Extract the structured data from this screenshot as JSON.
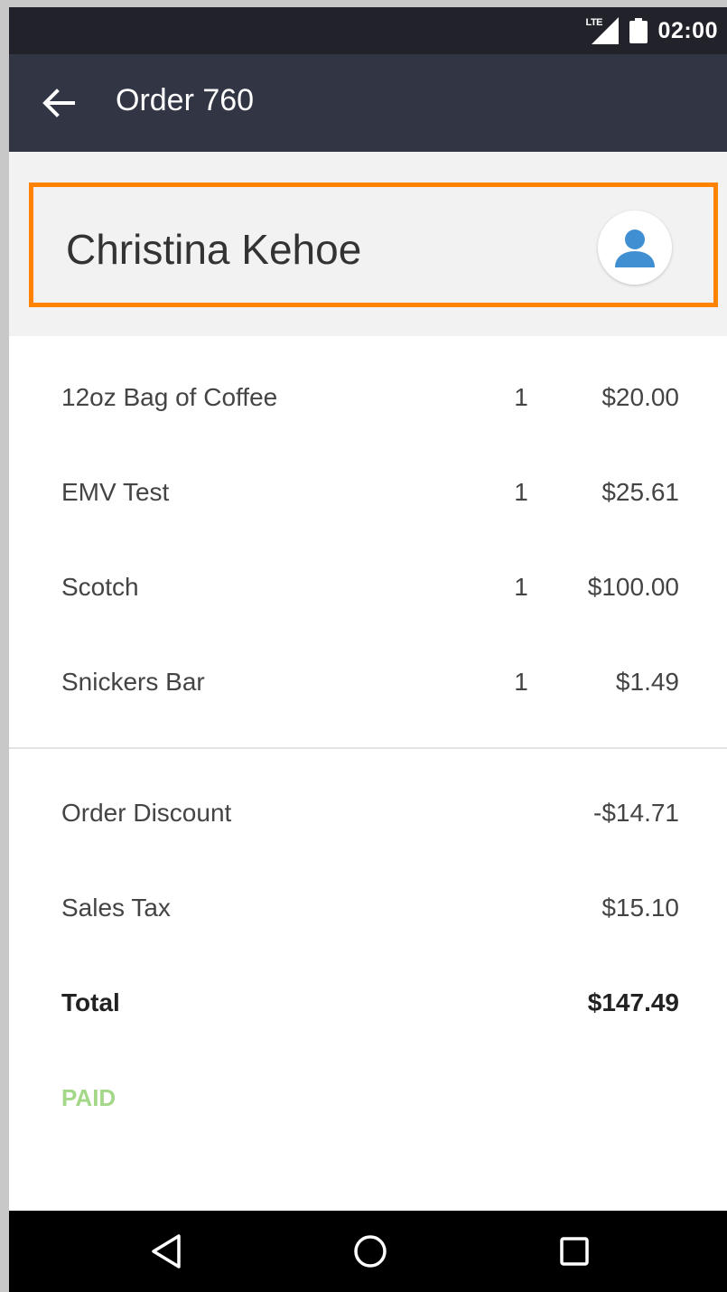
{
  "status_bar": {
    "network_label": "LTE",
    "time": "02:00",
    "icons": [
      "lte-signal-icon",
      "battery-icon"
    ]
  },
  "app_bar": {
    "title": "Order 760",
    "back_icon": "arrow-left-icon"
  },
  "customer": {
    "name": "Christina Kehoe",
    "avatar_icon": "person-icon",
    "highlight_color": "#ff8200"
  },
  "line_items": [
    {
      "name": "12oz Bag of Coffee",
      "quantity": "1",
      "price": "$20.00"
    },
    {
      "name": "EMV Test",
      "quantity": "1",
      "price": "$25.61"
    },
    {
      "name": "Scotch",
      "quantity": "1",
      "price": "$100.00"
    },
    {
      "name": "Snickers Bar",
      "quantity": "1",
      "price": "$1.49"
    }
  ],
  "summary": {
    "discount_label": "Order Discount",
    "discount_value": "-$14.71",
    "tax_label": "Sales Tax",
    "tax_value": "$15.10",
    "total_label": "Total",
    "total_value": "$147.49"
  },
  "status": {
    "label": "PAID",
    "color": "#a4d889"
  },
  "nav_bar": {
    "icons": [
      "back-triangle-icon",
      "home-circle-icon",
      "recents-square-icon"
    ]
  },
  "colors": {
    "app_bar": "#323644",
    "status_bar": "#22232a",
    "avatar_accent": "#3f8fd2"
  }
}
